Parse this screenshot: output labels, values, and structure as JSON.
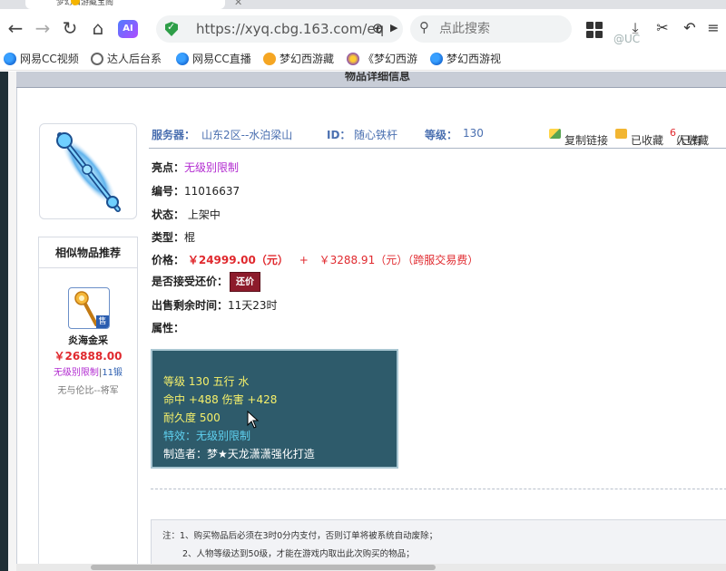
{
  "browser": {
    "tab_title": "梦幻西游藏宝阁",
    "url": "https://xyq.cbg.163.com/eq",
    "search_placeholder": "点此搜索",
    "ai_label": "AI",
    "watermark": "@UC"
  },
  "bookmarks": [
    {
      "label": "网易CC视频",
      "icon": "cc-icon"
    },
    {
      "label": "达人后台系",
      "icon": "globe-icon"
    },
    {
      "label": "网易CC直播",
      "icon": "cc-icon"
    },
    {
      "label": "梦幻西游藏",
      "icon": "hat-icon"
    },
    {
      "label": "《梦幻西游",
      "icon": "xy-icon"
    },
    {
      "label": "梦幻西游视",
      "icon": "cc-icon"
    }
  ],
  "page": {
    "header_title": "物品详细信息",
    "similar": {
      "title": "相似物品推荐",
      "sold_badge": "售",
      "name": "炎海金采",
      "price": "￥26888.00",
      "attr_special": "无级别限制",
      "attr_sep": "|",
      "attr_level": "11锻",
      "server": "无与伦比--将军"
    },
    "info": {
      "server_label": "服务器：",
      "server_value": "山东2区--水泊梁山",
      "id_label": "ID：",
      "id_value": "随心铁杆",
      "level_label": "等级：",
      "level_value": "130",
      "copy_link": "复制链接",
      "favorited": "已收藏",
      "fav_prefix": "（已有",
      "fav_count": "6",
      "fav_suffix": "人收藏"
    },
    "fields": {
      "highlight_label": "亮点：",
      "highlight_value": "无级别限制",
      "number_label": "编号：",
      "number_value": "11016637",
      "status_label": "状态：",
      "status_value": "上架中",
      "type_label": "类型：",
      "type_value": "棍",
      "price_label": "价格：",
      "price_value": "￥24999.00（元）",
      "price_plus": "+",
      "fee_value": "￥3288.91（元）（跨服交易费）",
      "haggle_label": "是否接受还价：",
      "haggle_button": "还价",
      "remaining_label": "出售剩余时间：",
      "remaining_value": "11天23时",
      "attributes_label": "属性："
    },
    "attributes": {
      "line1": "等级 130  五行 水",
      "line2": "命中 +488  伤害 +428",
      "line3": "耐久度 500",
      "line4": "特效：无级别限制",
      "line5": "制造者：梦★天龙潇潇强化打造"
    },
    "notes": {
      "line1": "注：1、购买物品后必须在3时0分内支付，否则订单将被系统自动废除；",
      "line2": "2、人物等级达到50级，才能在游戏内取出此次购买的物品；"
    }
  },
  "colors": {
    "accent_blue": "#4a6fb0",
    "price_red": "#e0292e",
    "purple": "#b22bd0",
    "attr_bg": "#2e5b6b",
    "attr_yellow": "#f6f06a",
    "attr_cyan": "#5fd1f0",
    "haggle_btn": "#8d1b2b"
  }
}
